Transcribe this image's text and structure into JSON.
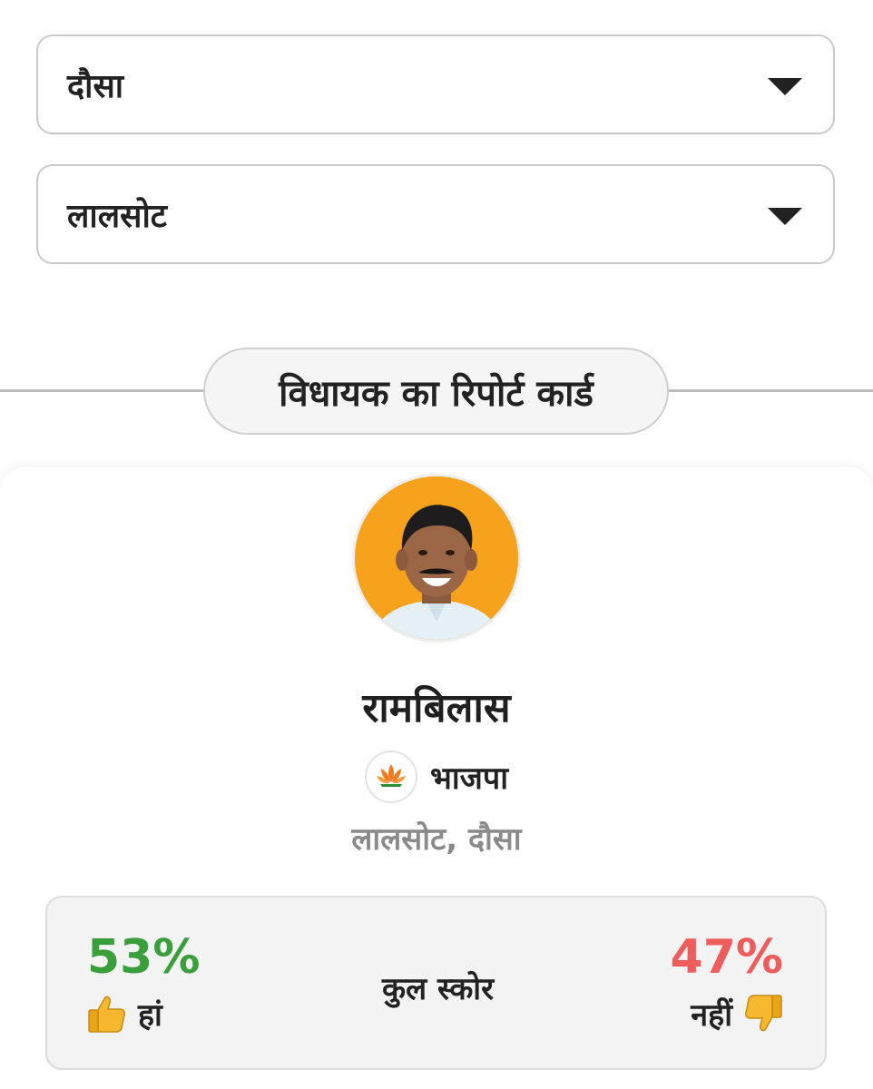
{
  "filters": {
    "district": {
      "value": "दौसा"
    },
    "constituency": {
      "value": "लालसोट"
    }
  },
  "section": {
    "title": "विधायक का रिपोर्ट कार्ड"
  },
  "mla": {
    "name": "रामबिलास",
    "party": "भाजपा",
    "location": "लालसोट, दौसा"
  },
  "score": {
    "yes_percent": "53%",
    "yes_label": "हां",
    "title": "कुल स्कोर",
    "no_percent": "47%",
    "no_label": "नहीं"
  },
  "colors": {
    "yes": "#3a9e3a",
    "no": "#ef5c5c",
    "avatar_bg": "#f6a21c",
    "party_saffron": "#f47a20"
  },
  "icons": {
    "dropdown": "chevron-down-icon",
    "yes": "thumbs-up-icon",
    "no": "thumbs-down-icon",
    "party": "lotus-icon"
  }
}
